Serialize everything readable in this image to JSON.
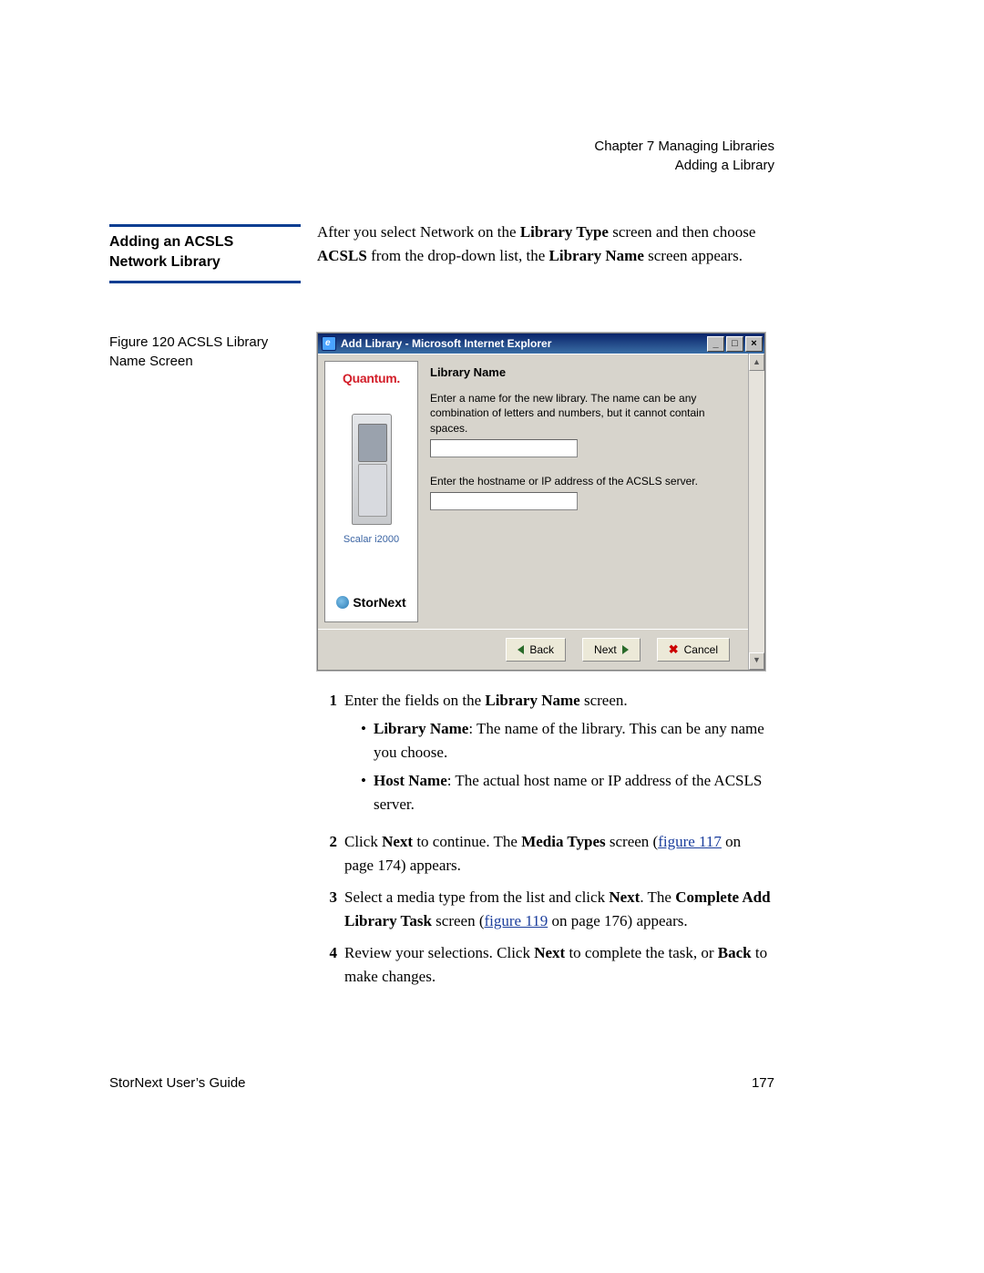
{
  "header": {
    "chapter": "Chapter 7  Managing Libraries",
    "section": "Adding a Library"
  },
  "sidebar": {
    "title_l1": "Adding an ACSLS",
    "title_l2": "Network Library"
  },
  "intro": {
    "p1a": "After you select Network on the ",
    "p1b": "Library Type",
    "p1c": " screen and then choose ",
    "p2a": "ACSLS",
    "p2b": " from the drop-down list, the ",
    "p2c": "Library Name",
    "p2d": " screen appears."
  },
  "figcap": {
    "l1": "Figure 120  ACSLS Library",
    "l2": "Name Screen"
  },
  "shot": {
    "title": "Add Library - Microsoft Internet Explorer",
    "brand": "Quantum.",
    "libModel": "Scalar i2000",
    "appLogo": "StorNext",
    "secTitle": "Library Name",
    "desc1a": "Enter a name for the new library. The name can be any",
    "desc1b": "combination of letters and numbers, but it cannot contain",
    "desc1c": "spaces.",
    "desc2": "Enter the hostname or IP address of the ACSLS server.",
    "btnBack": "Back",
    "btnNext": "Next",
    "btnCancel": "Cancel"
  },
  "steps": {
    "s1": {
      "text_a": "Enter the fields on the ",
      "text_b": "Library Name",
      "text_c": " screen."
    },
    "s1b1": {
      "label": "Library Name",
      "rest": ": The name of the library. This can be any name you choose."
    },
    "s1b2": {
      "label": "Host Name",
      "rest": ": The actual host name or IP address of the ACSLS server."
    },
    "s2": {
      "a": "Click ",
      "b": "Next",
      "c": " to continue. The ",
      "d": "Media Types",
      "e": " screen (",
      "link": "figure 117",
      "f": " on page 174) appears."
    },
    "s3": {
      "a": "Select a media type from the list and click ",
      "b": "Next",
      "c": ". The ",
      "d": "Complete Add Library Task",
      "e": " screen (",
      "link": "figure 119",
      "f": " on page 176) appears."
    },
    "s4": {
      "a": "Review your selections. Click ",
      "b": "Next",
      "c": " to complete the task, or ",
      "d": "Back",
      "e": " to make changes."
    }
  },
  "footer": {
    "left": "StorNext User’s Guide",
    "right": "177"
  }
}
